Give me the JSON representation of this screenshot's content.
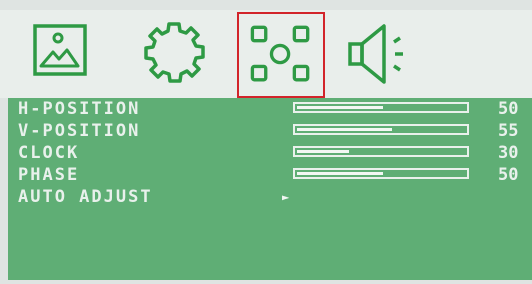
{
  "tabs": [
    {
      "name": "picture-tab",
      "icon": "picture-icon",
      "selected": false
    },
    {
      "name": "settings-tab",
      "icon": "gear-icon",
      "selected": false
    },
    {
      "name": "position-tab",
      "icon": "position-icon",
      "selected": true
    },
    {
      "name": "audio-tab",
      "icon": "speaker-icon",
      "selected": false
    }
  ],
  "menu": {
    "items": [
      {
        "label": "H-POSITION",
        "value": "50",
        "level": 0.5
      },
      {
        "label": "V-POSITION",
        "value": "55",
        "level": 0.55
      },
      {
        "label": "CLOCK",
        "value": "30",
        "level": 0.3
      },
      {
        "label": "PHASE",
        "value": "50",
        "level": 0.5
      },
      {
        "label": "AUTO ADJUST",
        "arrow": "►"
      }
    ]
  },
  "colors": {
    "panel": "#5fae75",
    "icon": "#2e9a44",
    "selected_border": "#d2242a",
    "text": "#e9f1ec"
  }
}
